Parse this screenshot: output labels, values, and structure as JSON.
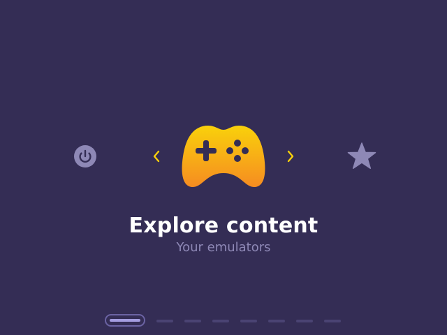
{
  "menu": {
    "title": "Explore content",
    "subtitle": "Your emulators",
    "items": [
      {
        "icon": "power-icon"
      },
      {
        "icon": "gamepad-icon",
        "selected": true
      },
      {
        "icon": "star-icon"
      }
    ]
  },
  "pagination": {
    "total_pages": 9,
    "active_page": 1
  },
  "colors": {
    "background": "#342d55",
    "accent_yellow": "#f9d10b",
    "accent_orange": "#f68c21",
    "muted_icon": "#8e88b6",
    "title_text": "#ffffff",
    "subtitle_text": "#8e88b6"
  }
}
